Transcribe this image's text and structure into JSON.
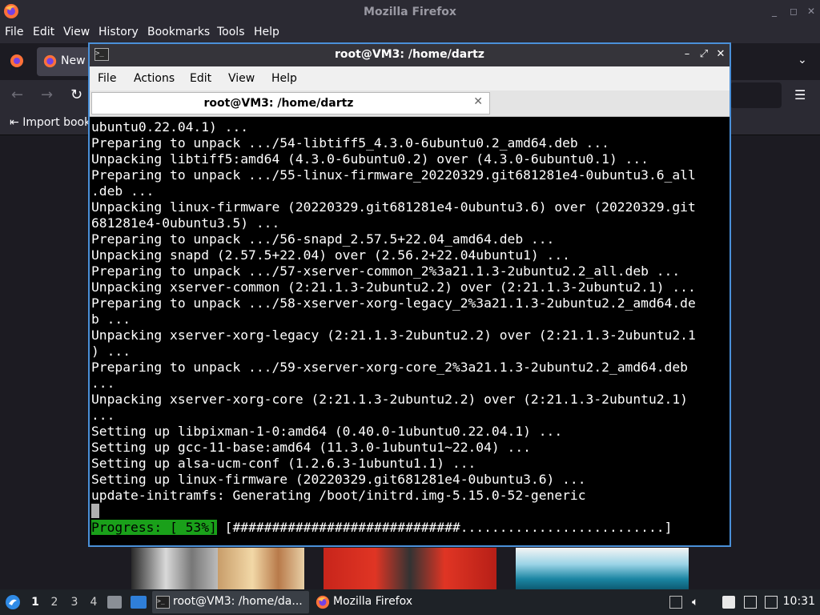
{
  "firefox": {
    "window_title": "Mozilla Firefox",
    "menu": [
      "File",
      "Edit",
      "View",
      "History",
      "Bookmarks",
      "Tools",
      "Help"
    ],
    "tab_label": "New",
    "import_label": "Import book"
  },
  "terminal": {
    "window_title": "root@VM3: /home/dartz",
    "menu": [
      "File",
      "Actions",
      "Edit",
      "View",
      "Help"
    ],
    "tab_label": "root@VM3: /home/dartz",
    "lines": [
      "ubuntu0.22.04.1) ...",
      "Preparing to unpack .../54-libtiff5_4.3.0-6ubuntu0.2_amd64.deb ...",
      "Unpacking libtiff5:amd64 (4.3.0-6ubuntu0.2) over (4.3.0-6ubuntu0.1) ...",
      "Preparing to unpack .../55-linux-firmware_20220329.git681281e4-0ubuntu3.6_all",
      ".deb ...",
      "Unpacking linux-firmware (20220329.git681281e4-0ubuntu3.6) over (20220329.git",
      "681281e4-0ubuntu3.5) ...",
      "Preparing to unpack .../56-snapd_2.57.5+22.04_amd64.deb ...",
      "Unpacking snapd (2.57.5+22.04) over (2.56.2+22.04ubuntu1) ...",
      "Preparing to unpack .../57-xserver-common_2%3a21.1.3-2ubuntu2.2_all.deb ...",
      "Unpacking xserver-common (2:21.1.3-2ubuntu2.2) over (2:21.1.3-2ubuntu2.1) ...",
      "Preparing to unpack .../58-xserver-xorg-legacy_2%3a21.1.3-2ubuntu2.2_amd64.de",
      "b ...",
      "Unpacking xserver-xorg-legacy (2:21.1.3-2ubuntu2.2) over (2:21.1.3-2ubuntu2.1",
      ") ...",
      "Preparing to unpack .../59-xserver-xorg-core_2%3a21.1.3-2ubuntu2.2_amd64.deb",
      "...",
      "Unpacking xserver-xorg-core (2:21.1.3-2ubuntu2.2) over (2:21.1.3-2ubuntu2.1)",
      "...",
      "Setting up libpixman-1-0:amd64 (0.40.0-1ubuntu0.22.04.1) ...",
      "Setting up gcc-11-base:amd64 (11.3.0-1ubuntu1~22.04) ...",
      "Setting up alsa-ucm-conf (1.2.6.3-1ubuntu1.1) ...",
      "Setting up linux-firmware (20220329.git681281e4-0ubuntu3.6) ...",
      "update-initramfs: Generating /boot/initrd.img-5.15.0-52-generic"
    ],
    "progress_label": "Progress: [ 53%]",
    "progress_bar": "[#############################..........................]",
    "progress_percent": 53
  },
  "taskbar": {
    "workspaces": [
      "1",
      "2",
      "3",
      "4"
    ],
    "active_workspace": "1",
    "tasks": [
      {
        "label": "root@VM3: /home/da...",
        "icon": "terminal-icon"
      },
      {
        "label": "Mozilla Firefox",
        "icon": "firefox-icon"
      }
    ],
    "clock": "10:31"
  },
  "colors": {
    "accent_border": "#4a90d9",
    "progress_green": "#1aa01a"
  }
}
